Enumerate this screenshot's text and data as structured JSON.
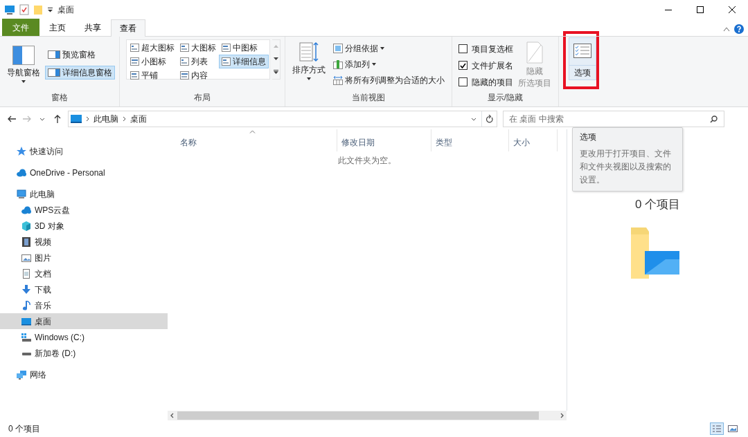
{
  "window": {
    "title": "桌面"
  },
  "tabs": [
    {
      "label": "文件",
      "kind": "file",
      "selected": false
    },
    {
      "label": "主页",
      "kind": "tab",
      "selected": false
    },
    {
      "label": "共享",
      "kind": "tab",
      "selected": false
    },
    {
      "label": "查看",
      "kind": "tab",
      "selected": true
    }
  ],
  "ribbon": {
    "panes": {
      "label": "窗格",
      "nav_pane": "导航窗格",
      "items": [
        {
          "label": "预览窗格",
          "selected": false
        },
        {
          "label": "详细信息窗格",
          "selected": true
        }
      ]
    },
    "layout": {
      "label": "布局",
      "items": [
        {
          "label": "超大图标",
          "selected": false
        },
        {
          "label": "大图标",
          "selected": false
        },
        {
          "label": "中图标",
          "selected": false
        },
        {
          "label": "小图标",
          "selected": false
        },
        {
          "label": "列表",
          "selected": false
        },
        {
          "label": "详细信息",
          "selected": true
        },
        {
          "label": "平铺",
          "selected": false
        },
        {
          "label": "内容",
          "selected": false
        }
      ]
    },
    "current_view": {
      "label": "当前视图",
      "sort": "排序方式",
      "group_by": "分组依据",
      "add_columns": "添加列",
      "fit_columns": "将所有列调整为合适的大小"
    },
    "show_hide": {
      "label": "显示/隐藏",
      "checkboxes": [
        {
          "label": "项目复选框",
          "checked": false
        },
        {
          "label": "文件扩展名",
          "checked": true
        },
        {
          "label": "隐藏的项目",
          "checked": false
        }
      ],
      "hide_selected": {
        "lines": [
          "隐藏",
          "所选项目"
        ],
        "disabled": true
      }
    },
    "options": {
      "label": "选项",
      "highlighted": true
    }
  },
  "address": {
    "path": [
      "此电脑",
      "桌面"
    ],
    "search_placeholder": "在 桌面 中搜索"
  },
  "tooltip": {
    "title": "选项",
    "text": "更改用于打开项目、文件和文件夹视图以及搜索的设置。"
  },
  "sidebar": {
    "items": [
      {
        "label": "快速访问",
        "kind": "star",
        "selected": false
      },
      {
        "label": "OneDrive - Personal",
        "kind": "cloud",
        "selected": false
      },
      {
        "label": "此电脑",
        "kind": "pc",
        "selected": false,
        "children": [
          {
            "label": "WPS云盘",
            "kind": "cloud",
            "selected": false
          },
          {
            "label": "3D 对象",
            "kind": "cube",
            "selected": false
          },
          {
            "label": "视频",
            "kind": "film",
            "selected": false
          },
          {
            "label": "图片",
            "kind": "image",
            "selected": false
          },
          {
            "label": "文档",
            "kind": "doc",
            "selected": false
          },
          {
            "label": "下载",
            "kind": "download",
            "selected": false
          },
          {
            "label": "音乐",
            "kind": "music",
            "selected": false
          },
          {
            "label": "桌面",
            "kind": "desktop",
            "selected": true
          },
          {
            "label": "Windows (C:)",
            "kind": "windrive",
            "selected": false
          },
          {
            "label": "新加卷 (D:)",
            "kind": "drive",
            "selected": false
          }
        ]
      },
      {
        "label": "网络",
        "kind": "network",
        "selected": false
      }
    ]
  },
  "table": {
    "columns": [
      {
        "label": "名称",
        "sorted": true
      },
      {
        "label": "修改日期",
        "sorted": false
      },
      {
        "label": "类型",
        "sorted": false
      },
      {
        "label": "大小",
        "sorted": false
      }
    ],
    "empty_message": "此文件夹为空。"
  },
  "preview": {
    "text": "0 个项目"
  },
  "status_bar": {
    "text": "0 个项目",
    "views": [
      {
        "kind": "details",
        "selected": true
      },
      {
        "kind": "large",
        "selected": false
      }
    ]
  }
}
